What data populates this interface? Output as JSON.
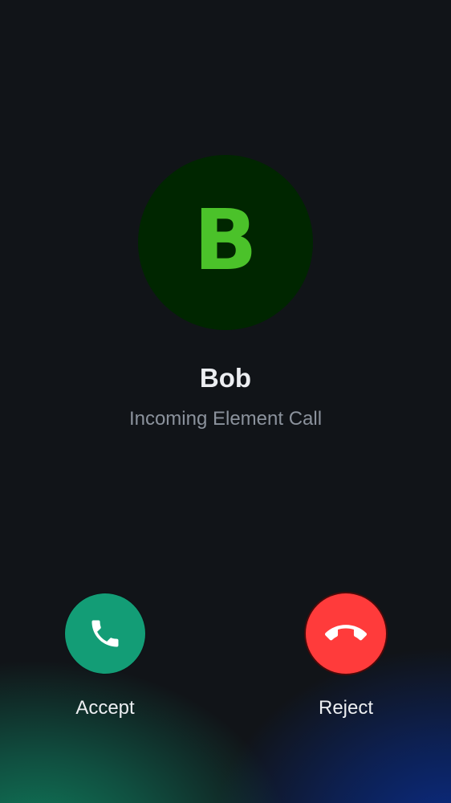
{
  "caller": {
    "initial": "B",
    "name": "Bob",
    "status": "Incoming Element Call"
  },
  "actions": {
    "accept_label": "Accept",
    "reject_label": "Reject"
  },
  "icons": {
    "accept": "phone-icon",
    "reject": "phone-hangup-icon"
  },
  "colors": {
    "background": "#111418",
    "avatar_bg": "#002600",
    "avatar_letter": "#4bc22a",
    "accept_button": "#139d76",
    "reject_button": "#ff3b3b",
    "name_text": "#eceef1",
    "status_text": "#8b929c"
  }
}
